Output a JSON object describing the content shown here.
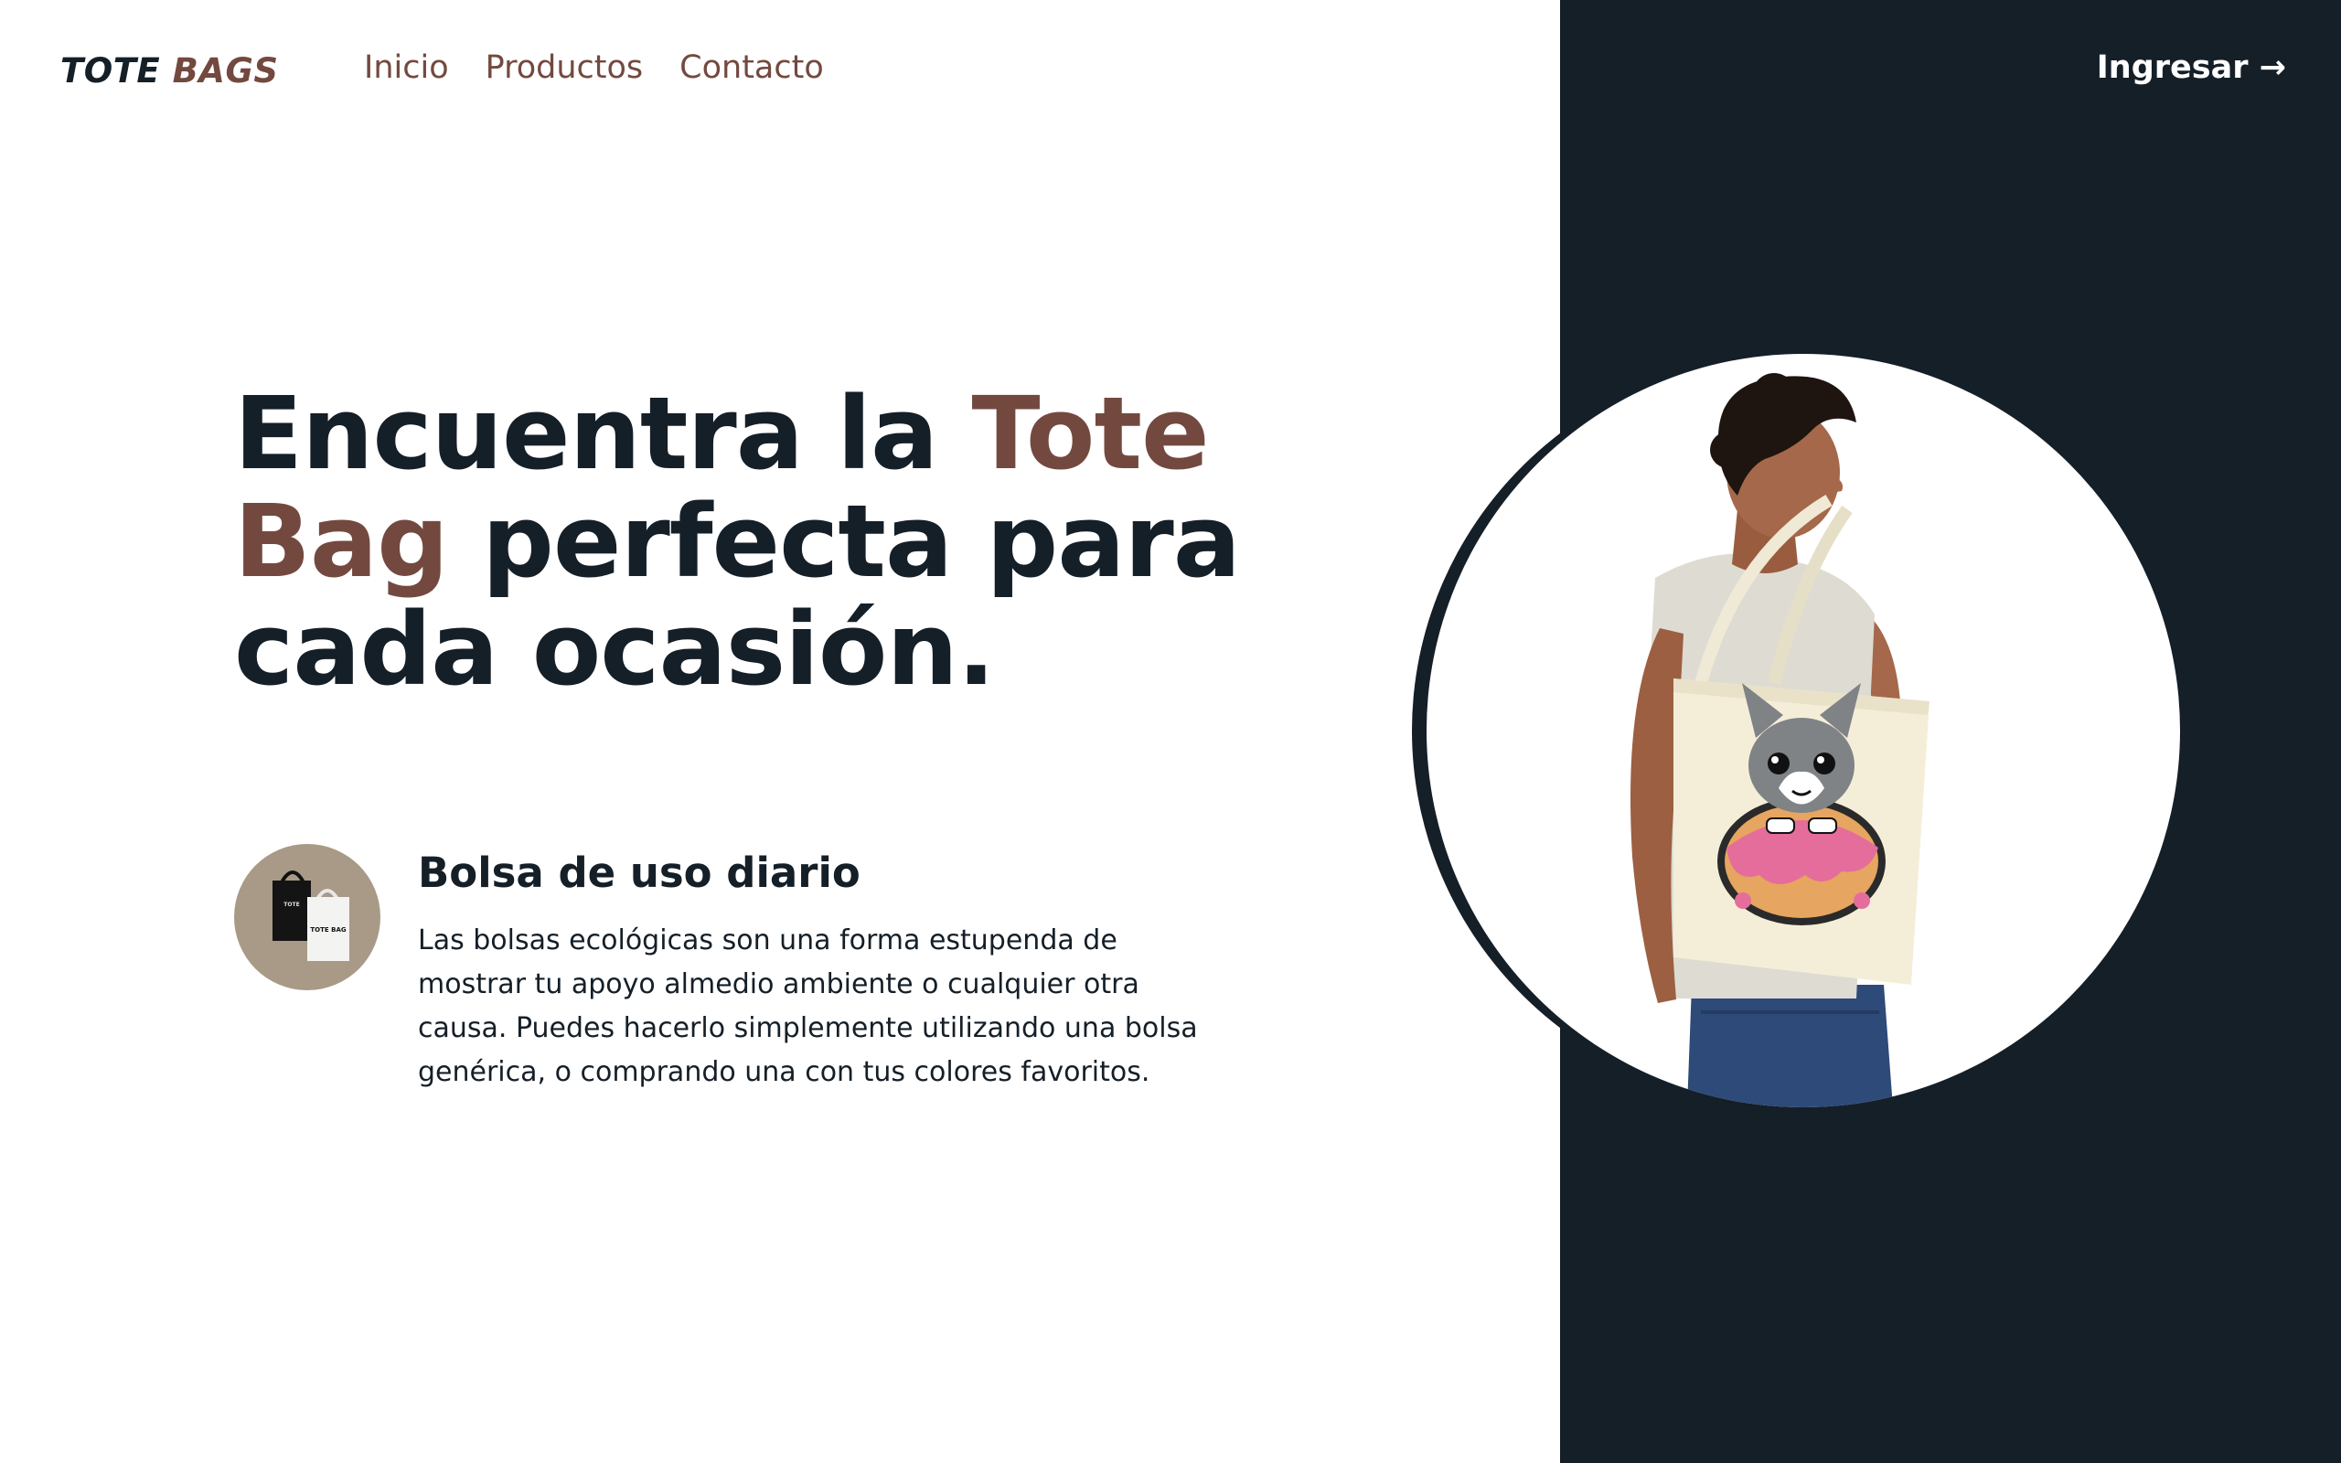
{
  "nav": {
    "logo_part1": "TOTE",
    "logo_part2": "BAGS",
    "links": [
      "Inicio",
      "Productos",
      "Contacto"
    ],
    "login_label": "Ingresar →"
  },
  "hero": {
    "title_part1": "Encuentra la ",
    "title_accent": "Tote Bag",
    "title_part2": " perfecta para cada ocasión."
  },
  "feature": {
    "title": "Bolsa de uso diario",
    "text": "Las bolsas ecológicas son una forma estupenda de mostrar tu apoyo almedio ambiente o cualquier otra causa. Puedes hacerlo simplemente utilizando una bolsa genérica, o comprando una con tus colores favoritos.",
    "thumb_bag_label": "TOTE BAG"
  },
  "colors": {
    "dark": "#151f28",
    "accent": "#73493f",
    "thumb_bg": "#a89a87",
    "white": "#ffffff"
  },
  "icons": {
    "arrow": "arrow-right-icon"
  }
}
